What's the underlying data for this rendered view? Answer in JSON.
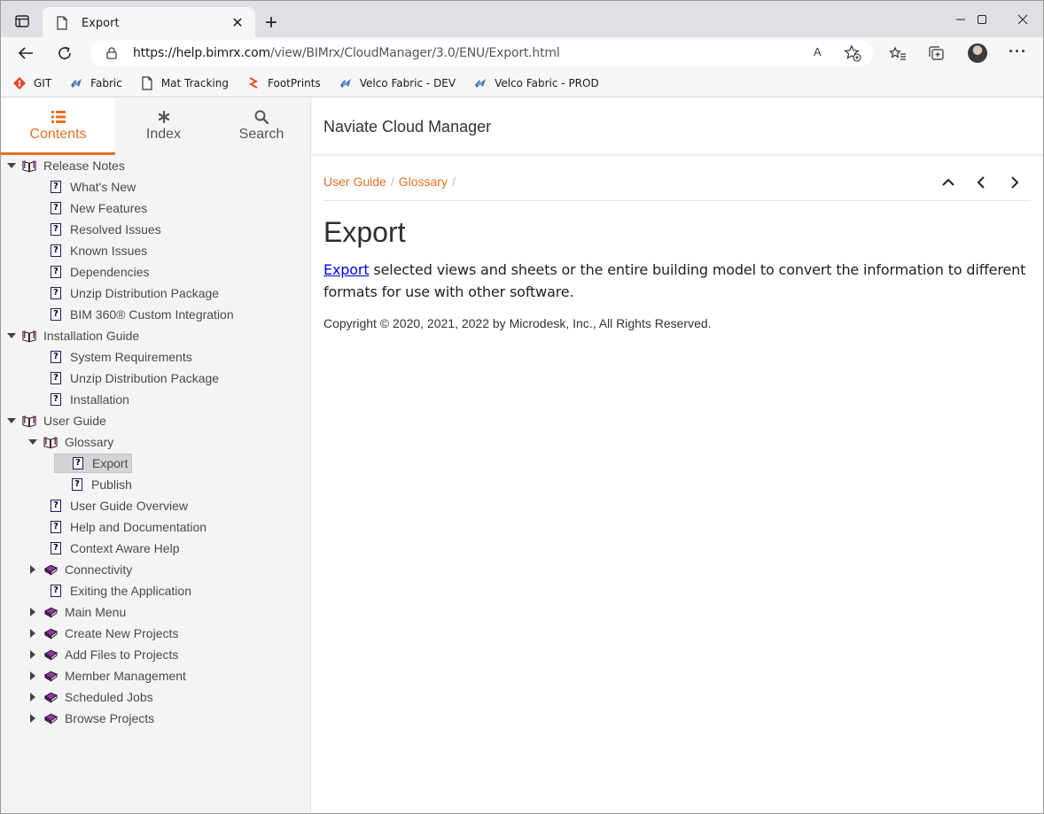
{
  "browser": {
    "tab_title": "Export",
    "tab_close": "✕",
    "new_tab": "+",
    "url_host": "https://help.bimrx.com",
    "url_path": "/view/BIMrx/CloudManager/3.0/ENU/Export.html",
    "read_aloud": "A",
    "more": "···",
    "bookmarks": [
      {
        "label": "GIT",
        "icon": "git-icon"
      },
      {
        "label": "Fabric",
        "icon": "fabric-icon"
      },
      {
        "label": "Mat Tracking",
        "icon": "page-icon"
      },
      {
        "label": "FootPrints",
        "icon": "footprints-icon"
      },
      {
        "label": "Velco Fabric - DEV",
        "icon": "fabric-icon"
      },
      {
        "label": "Velco Fabric - PROD",
        "icon": "fabric-icon"
      }
    ]
  },
  "sidebar": {
    "tabs": [
      {
        "label": "Contents",
        "icon": "list-icon",
        "active": true
      },
      {
        "label": "Index",
        "icon": "asterisk-icon",
        "active": false
      },
      {
        "label": "Search",
        "icon": "search-icon",
        "active": false
      }
    ],
    "tree": [
      {
        "label": "Release Notes",
        "type": "book-open",
        "level": 0,
        "expanded": true
      },
      {
        "label": "What's New",
        "type": "topic",
        "level": 1
      },
      {
        "label": "New Features",
        "type": "topic",
        "level": 1
      },
      {
        "label": "Resolved Issues",
        "type": "topic",
        "level": 1
      },
      {
        "label": "Known Issues",
        "type": "topic",
        "level": 1
      },
      {
        "label": "Dependencies",
        "type": "topic",
        "level": 1
      },
      {
        "label": "Unzip Distribution Package",
        "type": "topic",
        "level": 1
      },
      {
        "label": "BIM 360® Custom Integration",
        "type": "topic",
        "level": 1
      },
      {
        "label": "Installation Guide",
        "type": "book-open",
        "level": 0,
        "expanded": true
      },
      {
        "label": "System Requirements",
        "type": "topic",
        "level": 1
      },
      {
        "label": "Unzip Distribution Package",
        "type": "topic",
        "level": 1
      },
      {
        "label": "Installation",
        "type": "topic",
        "level": 1
      },
      {
        "label": "User Guide",
        "type": "book-open",
        "level": 0,
        "expanded": true
      },
      {
        "label": "Glossary",
        "type": "book-open",
        "level": 1,
        "expanded": true
      },
      {
        "label": "Export",
        "type": "topic",
        "level": 2,
        "selected": true
      },
      {
        "label": "Publish",
        "type": "topic",
        "level": 2
      },
      {
        "label": "User Guide Overview",
        "type": "topic",
        "level": 1
      },
      {
        "label": "Help and Documentation",
        "type": "topic",
        "level": 1
      },
      {
        "label": "Context Aware Help",
        "type": "topic",
        "level": 1
      },
      {
        "label": "Connectivity",
        "type": "book-closed",
        "level": 1,
        "expanded": false
      },
      {
        "label": "Exiting the Application",
        "type": "topic",
        "level": 1
      },
      {
        "label": "Main Menu",
        "type": "book-closed",
        "level": 1,
        "expanded": false
      },
      {
        "label": "Create New Projects",
        "type": "book-closed",
        "level": 1,
        "expanded": false
      },
      {
        "label": "Add Files to Projects",
        "type": "book-closed",
        "level": 1,
        "expanded": false
      },
      {
        "label": "Member Management",
        "type": "book-closed",
        "level": 1,
        "expanded": false
      },
      {
        "label": "Scheduled Jobs",
        "type": "book-closed",
        "level": 1,
        "expanded": false
      },
      {
        "label": "Browse Projects",
        "type": "book-closed",
        "level": 1,
        "expanded": false
      }
    ]
  },
  "main": {
    "site_title": "Naviate Cloud Manager",
    "breadcrumb": [
      "User Guide",
      "Glossary"
    ],
    "breadcrumb_sep": "/",
    "title": "Export",
    "body_link": "Export",
    "body_rest": " selected views and sheets or the entire building model to convert the information to different formats for use with other software.",
    "copyright": "Copyright © 2020, 2021, 2022 by Microdesk, Inc., All Rights Reserved."
  },
  "colors": {
    "accent": "#e86f22",
    "link": "#0000ee",
    "book_closed": "#7a2b8c"
  }
}
